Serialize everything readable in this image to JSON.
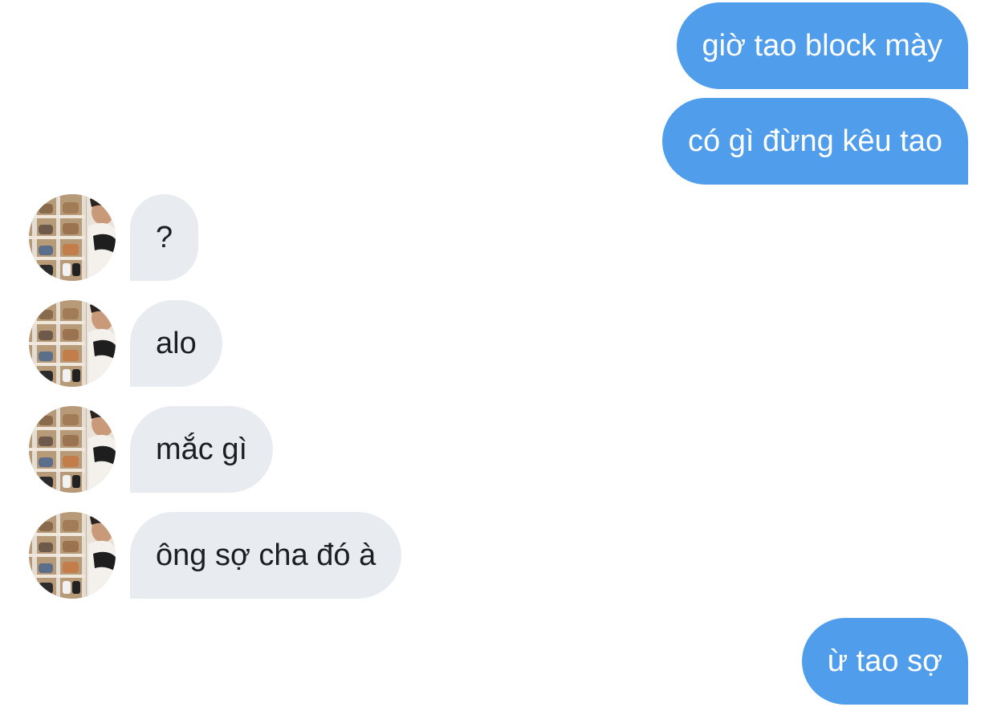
{
  "conversation": {
    "messages": [
      {
        "from": "me",
        "text": "giờ tao block mày"
      },
      {
        "from": "me",
        "text": "có gì đừng kêu tao"
      },
      {
        "from": "contact",
        "text": "?"
      },
      {
        "from": "contact",
        "text": "alo"
      },
      {
        "from": "contact",
        "text": "mắc gì"
      },
      {
        "from": "contact",
        "text": "ông sợ cha đó à"
      },
      {
        "from": "me",
        "text": "ừ tao sợ"
      }
    ]
  },
  "colors": {
    "outgoing_bubble": "#4f9deb",
    "incoming_bubble": "#e8ebf0",
    "outgoing_text": "#ffffff",
    "incoming_text": "#1c1e21"
  },
  "icons": {
    "contact_avatar": "contact-avatar-photo"
  }
}
